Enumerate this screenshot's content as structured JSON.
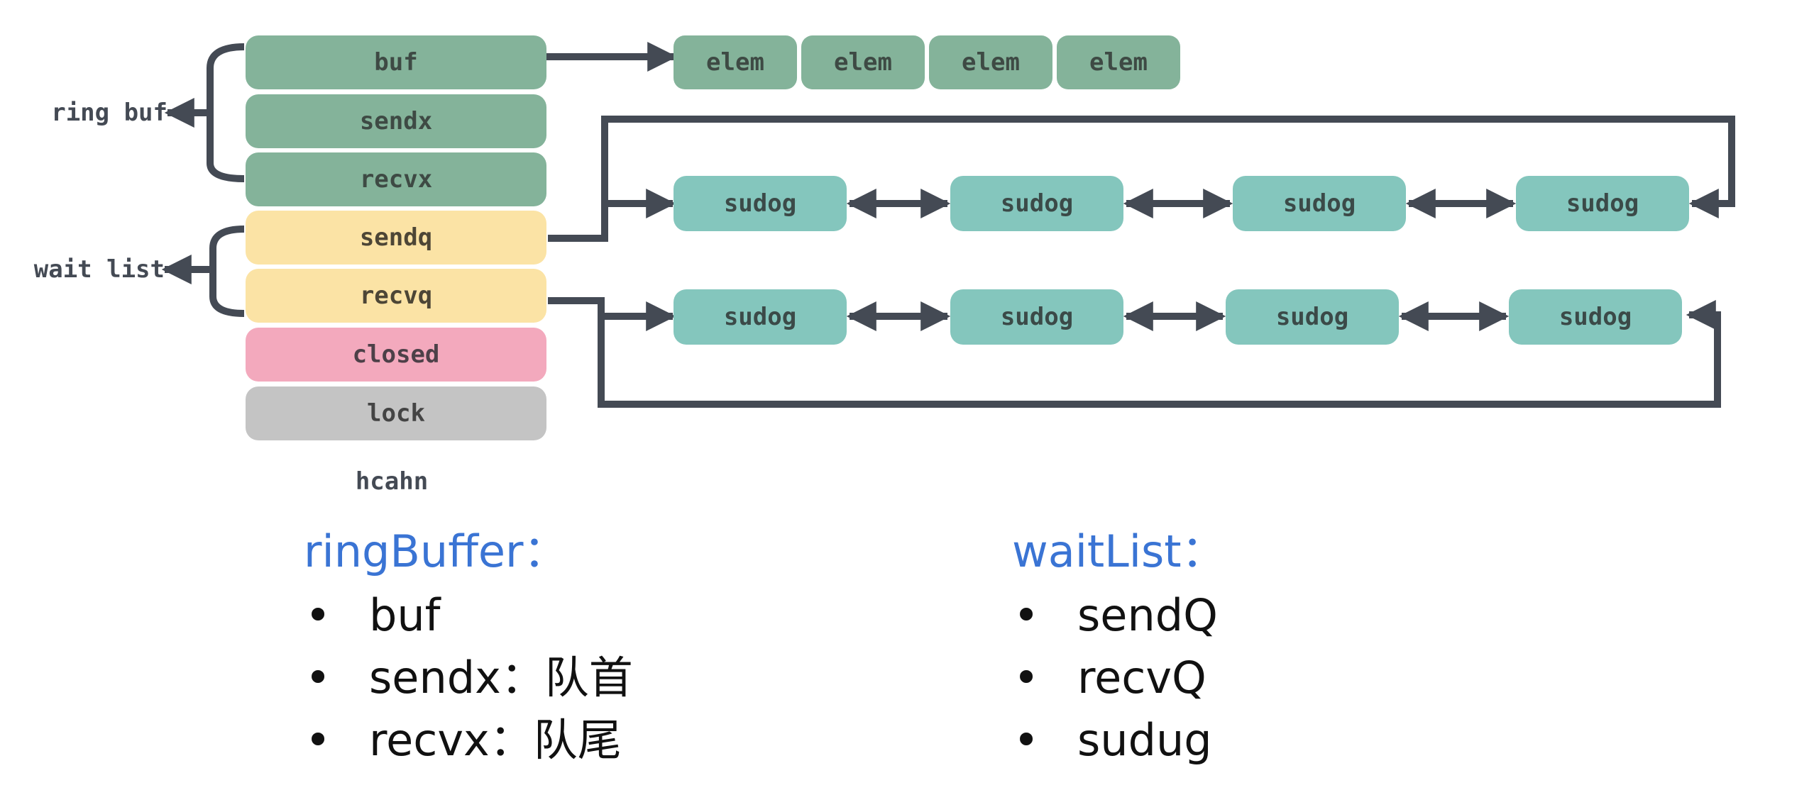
{
  "hchan": {
    "title": "hcahn",
    "fields": [
      {
        "label": "buf",
        "group": "ring"
      },
      {
        "label": "sendx",
        "group": "ring"
      },
      {
        "label": "recvx",
        "group": "ring"
      },
      {
        "label": "sendq",
        "group": "wait"
      },
      {
        "label": "recvq",
        "group": "wait"
      },
      {
        "label": "closed",
        "group": "closed"
      },
      {
        "label": "lock",
        "group": "lock"
      }
    ]
  },
  "labels": {
    "ring_buf": "ring buf",
    "wait_list": "wait list"
  },
  "buffer": {
    "elems": [
      "elem",
      "elem",
      "elem",
      "elem"
    ]
  },
  "send_queue": {
    "nodes": [
      "sudog",
      "sudog",
      "sudog",
      "sudog"
    ]
  },
  "recv_queue": {
    "nodes": [
      "sudog",
      "sudog",
      "sudog",
      "sudog"
    ]
  },
  "notes": {
    "ring_buffer": {
      "heading": "ringBuffer：",
      "items": [
        "buf",
        "sendx：队首",
        "recvx：队尾"
      ]
    },
    "wait_list": {
      "heading": "waitList：",
      "items": [
        "sendQ",
        "recvQ",
        "sudug"
      ]
    }
  },
  "colors": {
    "ring_field": "#84b39a",
    "wait_field": "#fbe3a5",
    "closed_field": "#f3a9bd",
    "lock_field": "#c4c4c4",
    "elem": "#84b39a",
    "sudog": "#84c6bd",
    "connector": "#444a54",
    "heading_blue": "#3a74d4"
  }
}
